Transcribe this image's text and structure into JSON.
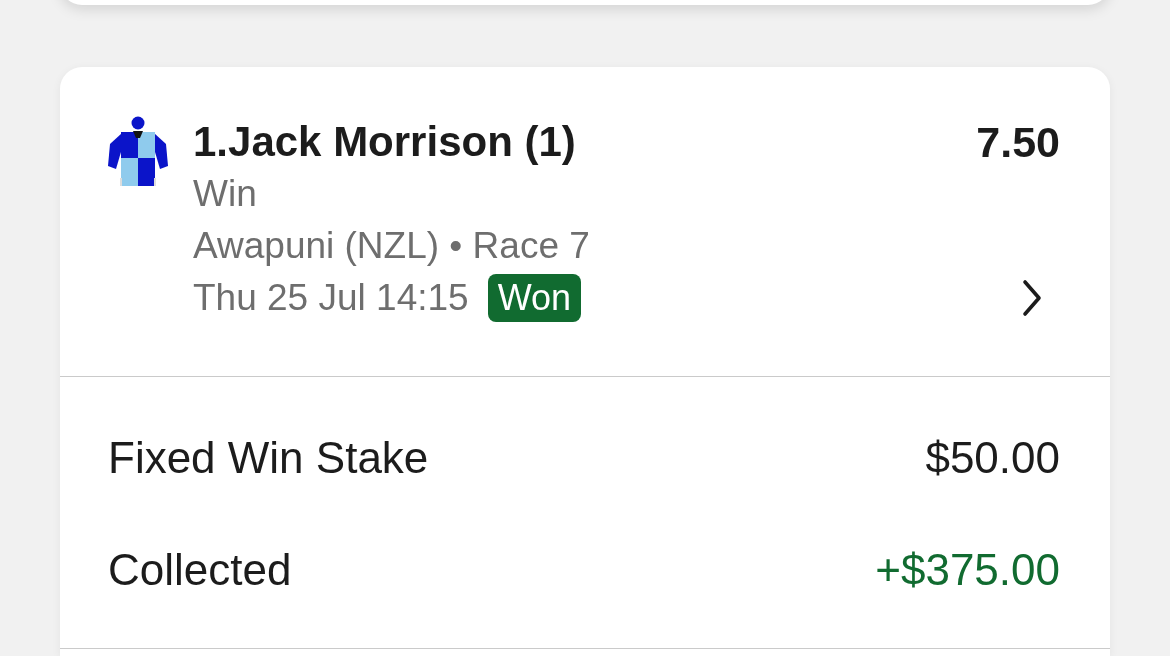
{
  "bet": {
    "selection": "1.Jack Morrison (1)",
    "odds": "7.50",
    "bet_type": "Win",
    "meeting": "Awapuni (NZL) • Race 7",
    "start_time": "Thu 25 Jul 14:15",
    "result": {
      "label": "Won",
      "kind": "won"
    }
  },
  "summary": [
    {
      "label": "Fixed Win Stake",
      "value": "$50.00",
      "kind": "neutral"
    },
    {
      "label": "Collected",
      "value": "+$375.00",
      "kind": "positive"
    }
  ]
}
